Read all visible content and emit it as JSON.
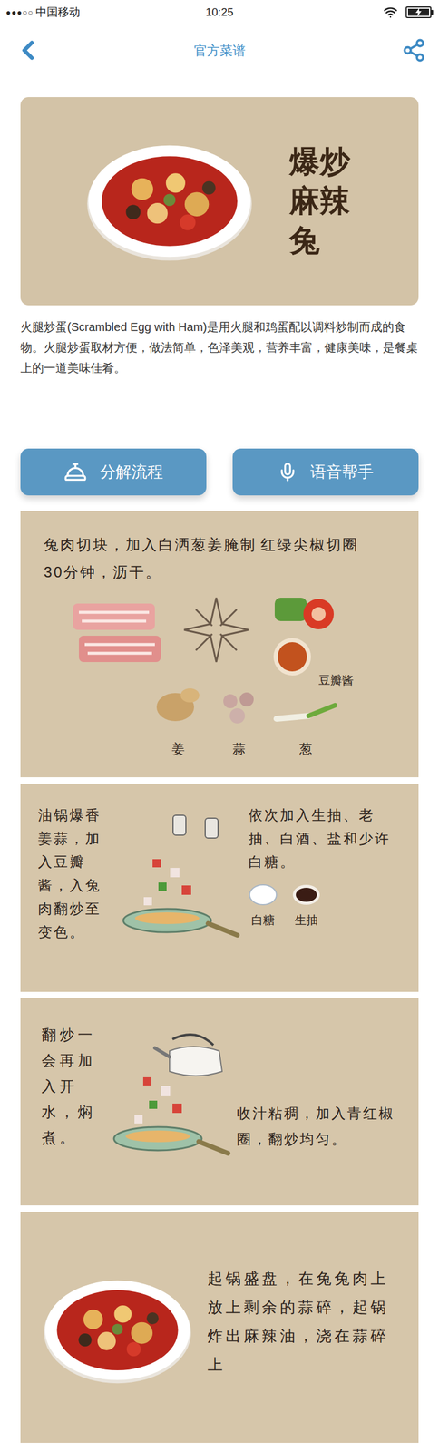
{
  "status_bar": {
    "signal": "●●●○○",
    "carrier": "中国移动",
    "time": "10:25",
    "battery": {
      "level": 1,
      "charging": true
    }
  },
  "nav": {
    "title": "官方菜谱"
  },
  "hero": {
    "title": "爆炒麻辣兔"
  },
  "description": "火腿炒蛋(Scrambled Egg with Ham)是用火腿和鸡蛋配以调料炒制而成的食物。火腿炒蛋取材方便，做法简单，色泽美观，营养丰富，健康美味，是餐桌上的一道美味佳肴。",
  "buttons": [
    {
      "label": "分解流程",
      "kind": "steps"
    },
    {
      "label": "语音帮手",
      "kind": "voice"
    }
  ],
  "steps": [
    {
      "kind": "prep",
      "texts": [
        "兔肉切块，加入白洒葱姜腌制30分钟，沥干。",
        "红绿尖椒切圈"
      ],
      "labels": [
        "豆瓣酱",
        "姜",
        "蒜",
        "葱"
      ]
    },
    {
      "kind": "fry",
      "texts": [
        "油锅爆香姜蒜，加入豆瓣酱，入兔肉翻炒至变色。",
        "依次加入生抽、老抽、白酒、盐和少许白糖。"
      ],
      "labels": [
        "白糖",
        "生抽"
      ]
    },
    {
      "kind": "simmer",
      "texts": [
        "翻炒一会再加入开水，焖煮。",
        "收汁粘稠，加入青红椒圈，翻炒均匀。"
      ]
    },
    {
      "kind": "serve",
      "texts": [
        "起锅盛盘，在兔兔肉上放上剩余的蒜碎，起锅炸出麻辣油，浇在蒜碎上"
      ]
    }
  ]
}
